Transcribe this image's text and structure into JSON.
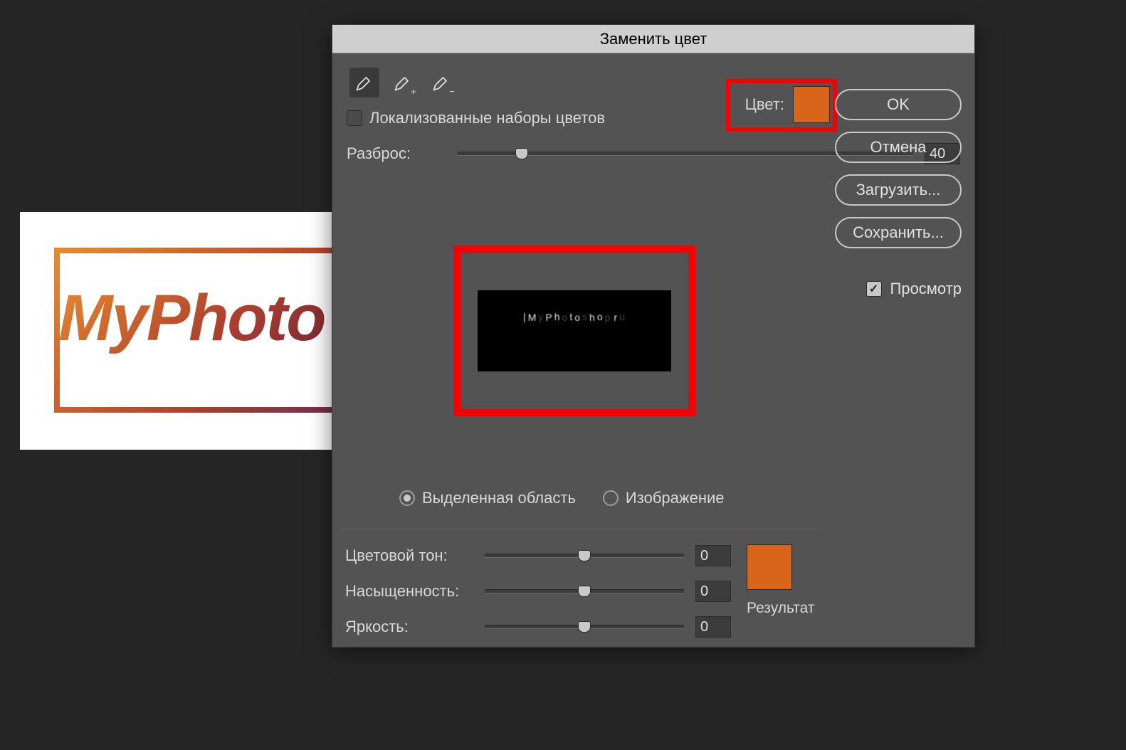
{
  "canvas": {
    "text": "MyPhoto"
  },
  "dialog": {
    "title": "Заменить цвет",
    "color_label": "Цвет:",
    "color_swatch": "#d8651a",
    "localized_checkbox": {
      "label": "Локализованные наборы цветов",
      "checked": false
    },
    "fuzziness": {
      "label": "Разброс:",
      "value": "40",
      "thumb_pct": 14
    },
    "view_mode": {
      "selection": {
        "label": "Выделенная область",
        "selected": true
      },
      "image": {
        "label": "Изображение",
        "selected": false
      }
    },
    "hue": {
      "label": "Цветовой тон:",
      "value": "0",
      "thumb_pct": 50
    },
    "saturation": {
      "label": "Насыщенность:",
      "value": "0",
      "thumb_pct": 50
    },
    "lightness": {
      "label": "Яркость:",
      "value": "0",
      "thumb_pct": 50
    },
    "result": {
      "label": "Результат",
      "swatch": "#d8651a"
    },
    "buttons": {
      "ok": "OK",
      "cancel": "Отмена",
      "load": "Загрузить...",
      "save": "Сохранить..."
    },
    "preview_chk": {
      "label": "Просмотр",
      "checked": true
    }
  }
}
